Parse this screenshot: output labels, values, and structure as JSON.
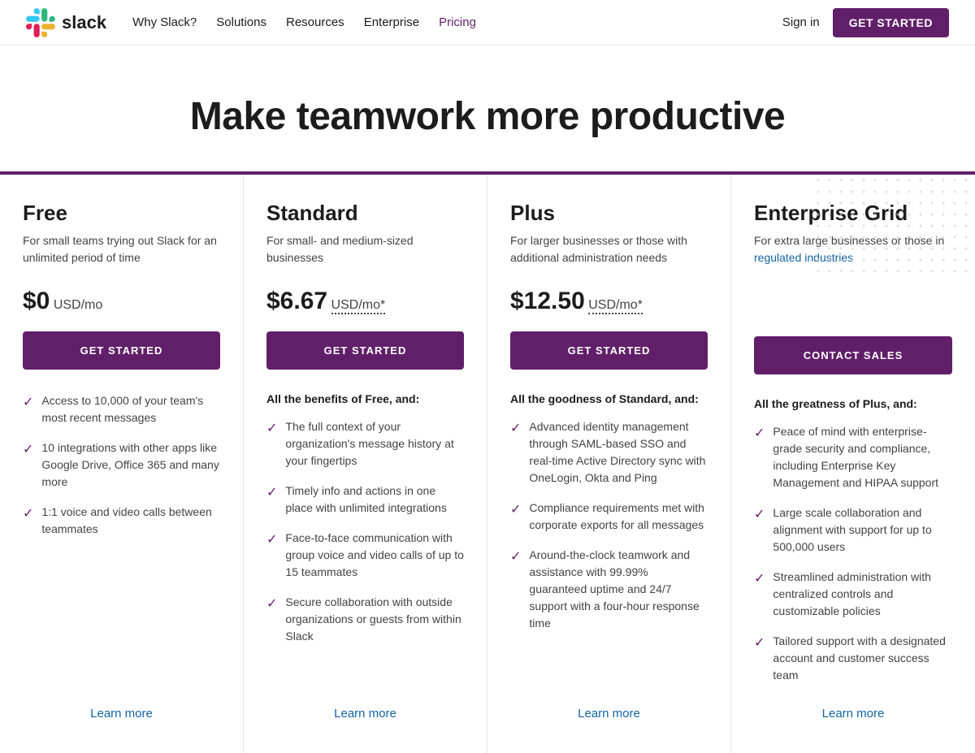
{
  "nav": {
    "logo_text": "slack",
    "links": [
      {
        "label": "Why Slack?",
        "id": "why-slack"
      },
      {
        "label": "Solutions",
        "id": "solutions"
      },
      {
        "label": "Resources",
        "id": "resources"
      },
      {
        "label": "Enterprise",
        "id": "enterprise"
      },
      {
        "label": "Pricing",
        "id": "pricing",
        "active": true
      }
    ],
    "sign_in": "Sign in",
    "get_started": "GET STARTED"
  },
  "hero": {
    "title": "Make teamwork more productive"
  },
  "plans": [
    {
      "id": "free",
      "name": "Free",
      "desc": "For small teams trying out Slack for an unlimited period of time",
      "price": "$0",
      "price_unit": "USD/mo",
      "price_dotted": false,
      "cta": "GET STARTED",
      "benefits_label": null,
      "benefits": [
        "Access to 10,000 of your team's most recent messages",
        "10 integrations with other apps like Google Drive, Office 365 and many more",
        "1:1 voice and video calls between teammates"
      ],
      "learn_more": "Learn more"
    },
    {
      "id": "standard",
      "name": "Standard",
      "desc": "For small- and medium-sized businesses",
      "price": "$6.67",
      "price_unit": "USD/mo*",
      "price_dotted": true,
      "cta": "GET STARTED",
      "benefits_label": "All the benefits of Free, and:",
      "benefits": [
        "The full context of your organization's message history at your fingertips",
        "Timely info and actions in one place with unlimited integrations",
        "Face-to-face communication with group voice and video calls of up to 15 teammates",
        "Secure collaboration with outside organizations or guests from within Slack"
      ],
      "learn_more": "Learn more"
    },
    {
      "id": "plus",
      "name": "Plus",
      "desc": "For larger businesses or those with additional administration needs",
      "price": "$12.50",
      "price_unit": "USD/mo*",
      "price_dotted": true,
      "cta": "GET STARTED",
      "benefits_label": "All the goodness of Standard, and:",
      "benefits": [
        "Advanced identity management through SAML-based SSO and real-time Active Directory sync with OneLogin, Okta and Ping",
        "Compliance requirements met with corporate exports for all messages",
        "Around-the-clock teamwork and assistance with 99.99% guaranteed uptime and 24/7 support with a four-hour response time"
      ],
      "learn_more": "Learn more"
    },
    {
      "id": "enterprise",
      "name": "Enterprise Grid",
      "desc_plain": "For extra large businesses or those in",
      "desc_link": "regulated industries",
      "desc_after": "",
      "price": null,
      "price_unit": null,
      "price_dotted": false,
      "cta": "CONTACT SALES",
      "benefits_label": "All the greatness of Plus, and:",
      "benefits": [
        "Peace of mind with enterprise-grade security and compliance, including Enterprise Key Management and HIPAA support",
        "Large scale collaboration and alignment with support for up to 500,000 users",
        "Streamlined administration with centralized controls and customizable policies",
        "Tailored support with a designated account and customer success team"
      ],
      "learn_more": "Learn more"
    }
  ]
}
